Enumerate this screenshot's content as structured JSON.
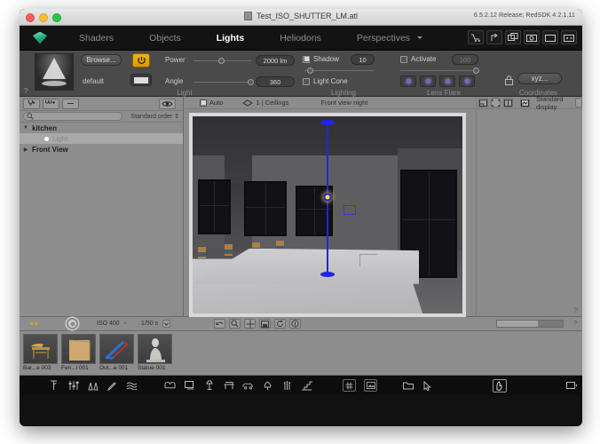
{
  "titlebar": {
    "document": "Test_ISO_SHUTTER_LM.atl",
    "version": "6.5.2.12 Release; RedSDK 4.2.1.11"
  },
  "menubar": {
    "tabs": [
      {
        "label": "Shaders",
        "active": false
      },
      {
        "label": "Objects",
        "active": false
      },
      {
        "label": "Lights",
        "active": true
      },
      {
        "label": "Heliodons",
        "active": false
      },
      {
        "label": "Perspectives",
        "active": false
      }
    ],
    "icons": [
      "cart-icon",
      "import-icon",
      "duplicate-icon",
      "camera-icon",
      "window-icon",
      "media-icon"
    ]
  },
  "properties": {
    "preview_label": "default",
    "browse_label": "Browse...",
    "light": {
      "section": "Light",
      "power_label": "Power",
      "power_value": "2000 lm",
      "angle_label": "Angle",
      "angle_value": "360"
    },
    "lighting": {
      "section": "Lighting",
      "shadow_label": "Shadow",
      "shadow_value": "10",
      "shadow_checked": true,
      "light_cone_label": "Light Cone",
      "light_cone_checked": false
    },
    "lens_flare": {
      "section": "Lens Flare",
      "activate_label": "Activate",
      "activate_checked": false,
      "intensity_value": "100",
      "presets": 4
    },
    "coordinates": {
      "section": "Coordinates",
      "button_label": "xyz..."
    }
  },
  "tree": {
    "search_placeholder": "",
    "order_label": "Standard order",
    "nodes": [
      {
        "label": "kitchen",
        "depth": 0,
        "expanded": true,
        "selected": false,
        "bold": true
      },
      {
        "label": "Light",
        "depth": 1,
        "expanded": false,
        "selected": true,
        "bold": false
      },
      {
        "label": "Front View",
        "depth": 0,
        "expanded": false,
        "selected": false,
        "bold": true
      }
    ]
  },
  "viewport": {
    "auto_label": "Auto",
    "auto_checked": true,
    "layer_label": "1 | Ceilings",
    "view_name": "Front view night"
  },
  "display": {
    "mode_label": "Standard display"
  },
  "renderbar": {
    "iso_label": "ISO 400",
    "separator": "-",
    "shutter_label": "1/50 s",
    "help": "?"
  },
  "thumbnails": [
    {
      "caption": "Bar...e 003",
      "kind": "stool-thumb"
    },
    {
      "caption": "Fen...l 001",
      "kind": "panel-thumb"
    },
    {
      "caption": "Out...e 001",
      "kind": "slide-thumb"
    },
    {
      "caption": "Statue 001",
      "kind": "statue-thumb"
    }
  ],
  "bottom_toolbar": {
    "group1": [
      "measure-icon",
      "settings-sliders-icon",
      "mirror-icon",
      "pen-icon",
      "wave-icon"
    ],
    "group2": [
      "sofa-icon",
      "screen-icon",
      "lamp-icon",
      "table-icon",
      "car-icon",
      "tree-icon",
      "plant-icon",
      "stairs-icon"
    ],
    "group3": [
      "grid-icon",
      "image-icon",
      "folder-icon",
      "cursor-icon"
    ],
    "group4": [
      "hand-icon"
    ],
    "group5": [
      "window-icon"
    ]
  },
  "colors": {
    "accent_orange": "#e8a81a",
    "gizmo_blue": "#2222ee",
    "light_yellow": "#ffe14a",
    "panel_gray": "#8d8d8d",
    "props_gray": "#4a4a4a"
  }
}
